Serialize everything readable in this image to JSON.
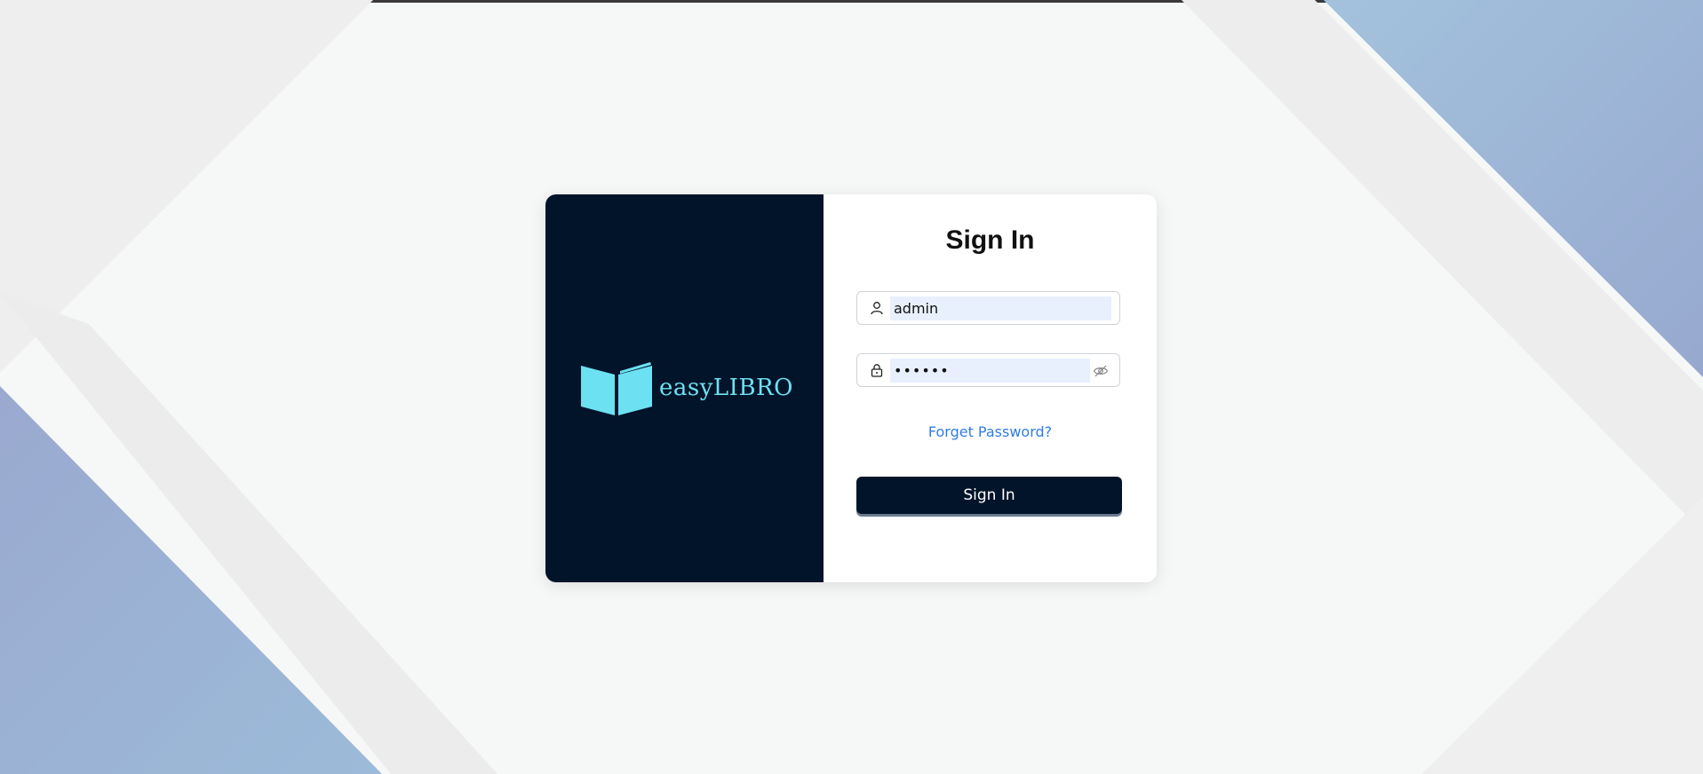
{
  "brand": {
    "logo_text": "easyLIBRO",
    "logo_icon": "open-book-icon"
  },
  "form": {
    "title": "Sign In",
    "username": {
      "value": "admin",
      "icon": "user-icon"
    },
    "password": {
      "value": "••••••",
      "icon": "lock-icon",
      "toggle_icon": "eye-slash-icon"
    },
    "forgot_label": "Forget Password?",
    "submit_label": "Sign In"
  },
  "colors": {
    "panel_dark": "#02142a",
    "logo_cyan": "#6ce1f1",
    "link_blue": "#2f7de1",
    "autofill_blue": "#e8f0fe",
    "background_blue": "#98b4d6"
  }
}
